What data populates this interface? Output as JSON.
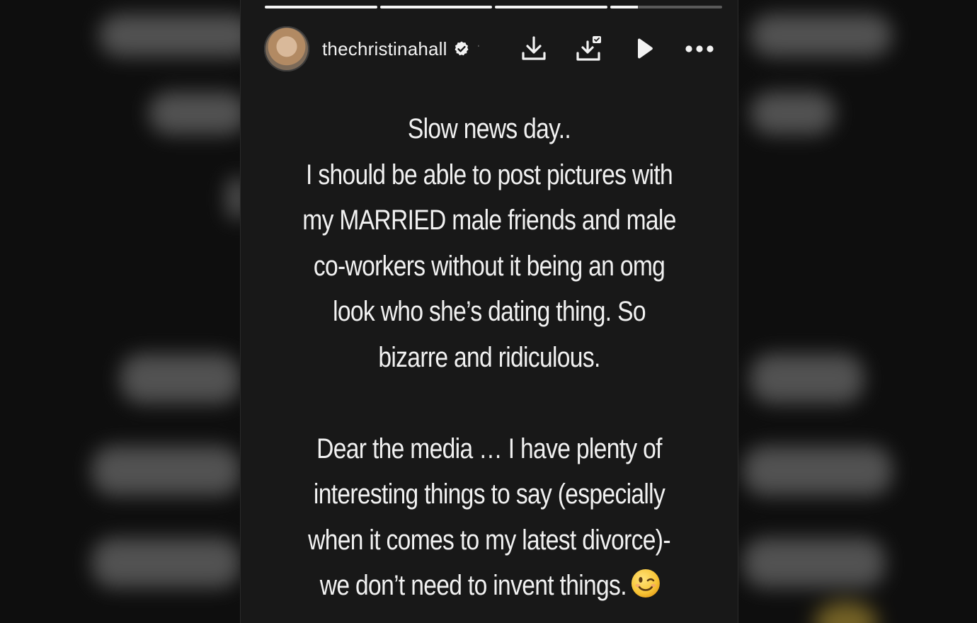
{
  "story": {
    "progress_segments": [
      1,
      1,
      1,
      0.25
    ],
    "username": "thechristinahall",
    "verified_icon": "verified-badge-icon",
    "header_icons": [
      "download-icon",
      "save-to-archive-icon",
      "play-icon",
      "more-options-icon"
    ],
    "text_lines": [
      "Slow news day..",
      "I should be able to post pictures with",
      "my MARRIED male friends and male",
      "co-workers without it being an omg",
      "look who she’s dating thing. So",
      "bizarre and ridiculous.",
      "",
      "Dear the media … I have plenty of",
      "interesting things to say (especially",
      "when it comes to my latest divorce)-",
      "we don’t need to invent things."
    ],
    "end_emoji": "winking-face-emoji"
  },
  "colors": {
    "panel_bg": "#181818",
    "text": "#f1f1f1",
    "progress_active": "#f5f5f5",
    "progress_inactive": "#5a5a5a"
  }
}
